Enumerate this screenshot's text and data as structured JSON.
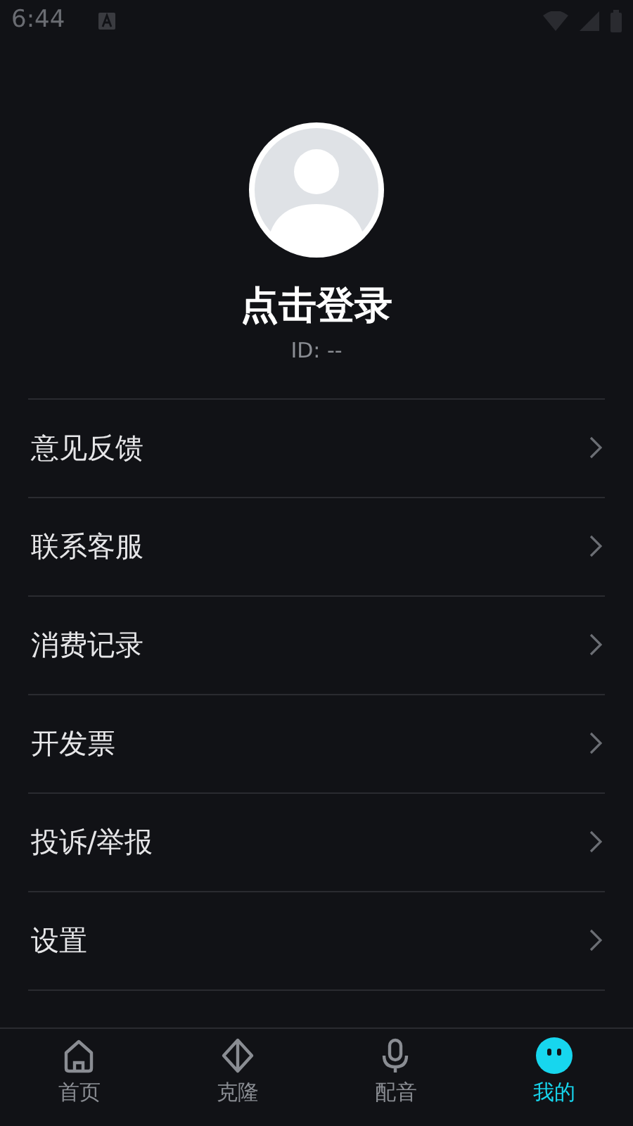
{
  "status_bar": {
    "time": "6:44"
  },
  "profile": {
    "title": "点击登录",
    "id": "ID: --"
  },
  "menu": [
    {
      "label": "意见反馈"
    },
    {
      "label": "联系客服"
    },
    {
      "label": "消费记录"
    },
    {
      "label": "开发票"
    },
    {
      "label": "投诉/举报"
    },
    {
      "label": "设置"
    }
  ],
  "tabs": [
    {
      "label": "首页",
      "kind": "home",
      "selected": false
    },
    {
      "label": "克隆",
      "kind": "clone",
      "selected": false
    },
    {
      "label": "配音",
      "kind": "mic",
      "selected": false
    },
    {
      "label": "我的",
      "kind": "face",
      "selected": true
    }
  ]
}
